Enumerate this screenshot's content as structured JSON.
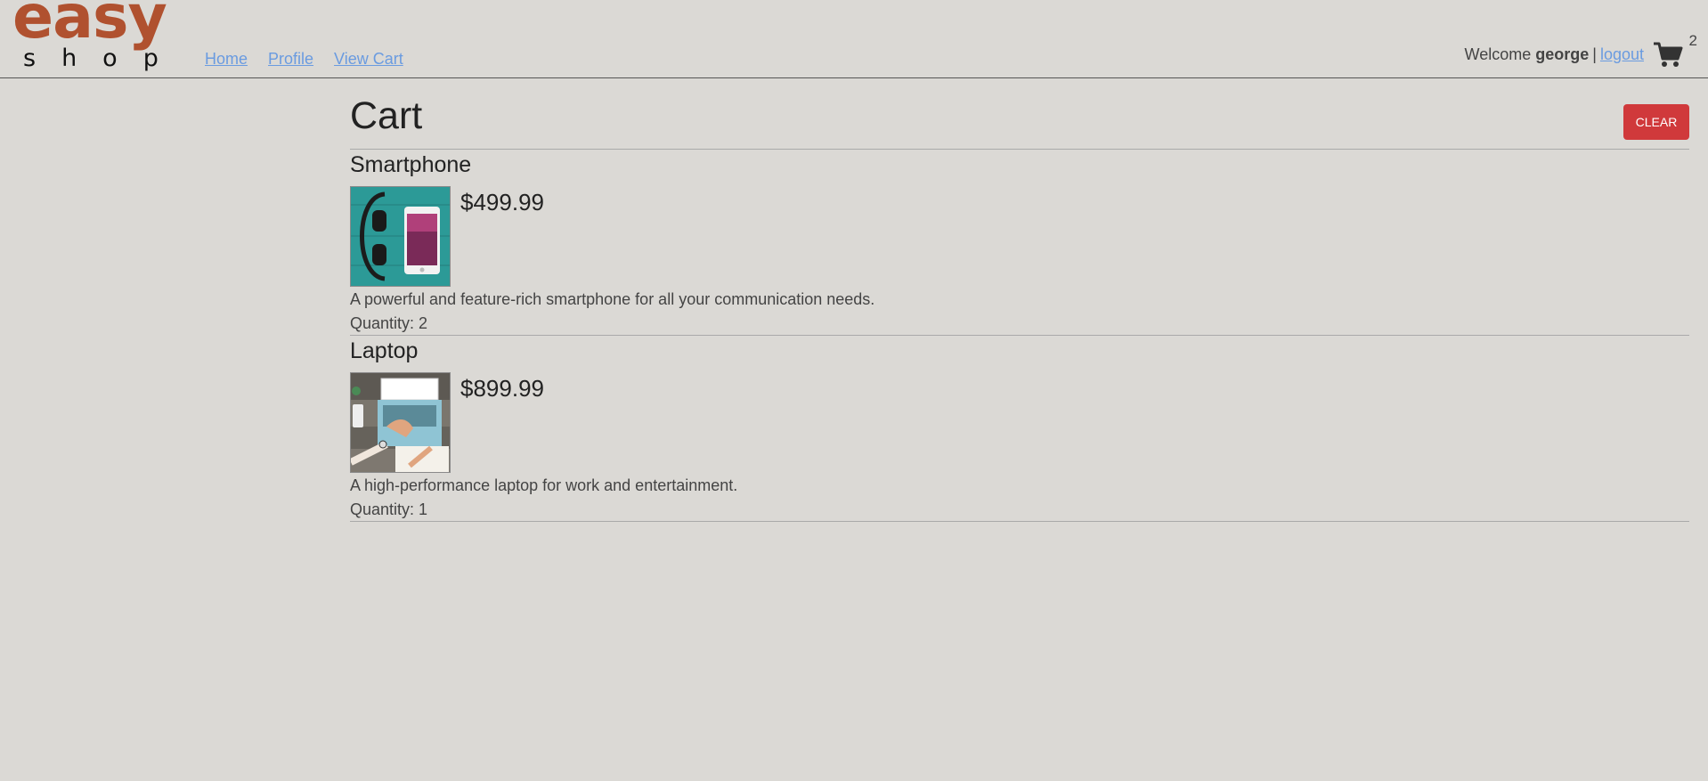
{
  "brand": {
    "word1": "easy",
    "word2": "shop"
  },
  "nav": {
    "home": "Home",
    "profile": "Profile",
    "view_cart": "View Cart"
  },
  "user": {
    "welcome": "Welcome",
    "username": "george",
    "separator": "|",
    "logout": "logout",
    "cart_icon": "shopping-cart-icon",
    "cart_count": "2"
  },
  "cart": {
    "title": "Cart",
    "clear_label": "CLEAR",
    "items": [
      {
        "name": "Smartphone",
        "price": "$499.99",
        "description": "A powerful and feature-rich smartphone for all your communication needs.",
        "quantity": "Quantity: 2"
      },
      {
        "name": "Laptop",
        "price": "$899.99",
        "description": "A high-performance laptop for work and entertainment.",
        "quantity": "Quantity: 1"
      }
    ]
  },
  "colors": {
    "background": "#dbd9d5",
    "brand": "#b0512f",
    "link": "#6a9be0",
    "clear_button": "#d0393b"
  }
}
